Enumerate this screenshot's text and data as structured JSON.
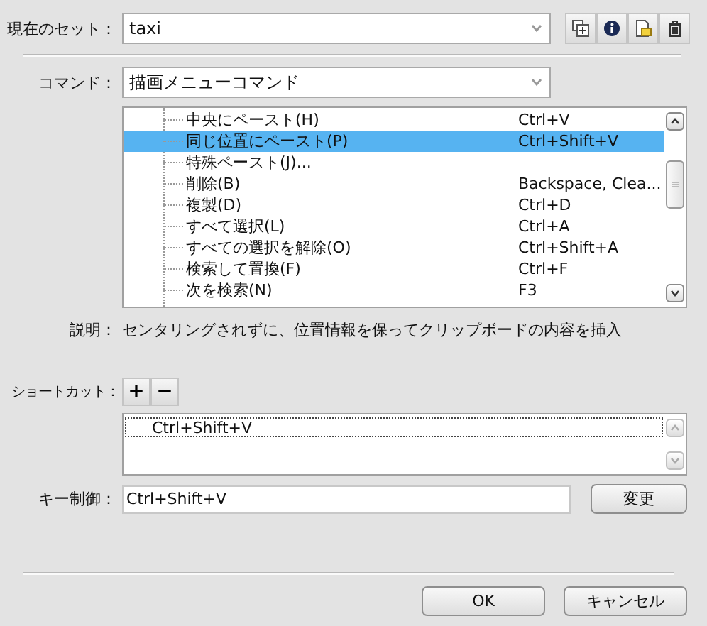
{
  "current_set": {
    "label": "現在のセット：",
    "value": "taxi"
  },
  "command": {
    "label": "コマンド：",
    "value": "描画メニューコマンド"
  },
  "commands": [
    {
      "name": "中央にペースト(H)",
      "shortcut": "Ctrl+V",
      "selected": false
    },
    {
      "name": "同じ位置にペースト(P)",
      "shortcut": "Ctrl+Shift+V",
      "selected": true
    },
    {
      "name": "特殊ペースト(J)...",
      "selected": false
    },
    {
      "name": "削除(B)",
      "shortcut": "Backspace, Clea...",
      "selected": false
    },
    {
      "name": "複製(D)",
      "shortcut": "Ctrl+D",
      "selected": false
    },
    {
      "name": "すべて選択(L)",
      "shortcut": "Ctrl+A",
      "selected": false
    },
    {
      "name": "すべての選択を解除(O)",
      "shortcut": "Ctrl+Shift+A",
      "selected": false
    },
    {
      "name": "検索して置換(F)",
      "shortcut": "Ctrl+F",
      "selected": false
    },
    {
      "name": "次を検索(N)",
      "shortcut": "F3",
      "selected": false
    }
  ],
  "description": {
    "label": "説明：",
    "text": "センタリングされずに、位置情報を保ってクリップボードの内容を挿入"
  },
  "shortcuts": {
    "label": "ショートカット：",
    "add": "+",
    "remove": "−",
    "items": [
      {
        "text": "Ctrl+Shift+V",
        "selected": true
      }
    ]
  },
  "key_control": {
    "label": "キー制御：",
    "value": "Ctrl+Shift+V",
    "button": "変更"
  },
  "buttons": [
    "OK",
    "キャンセル"
  ]
}
